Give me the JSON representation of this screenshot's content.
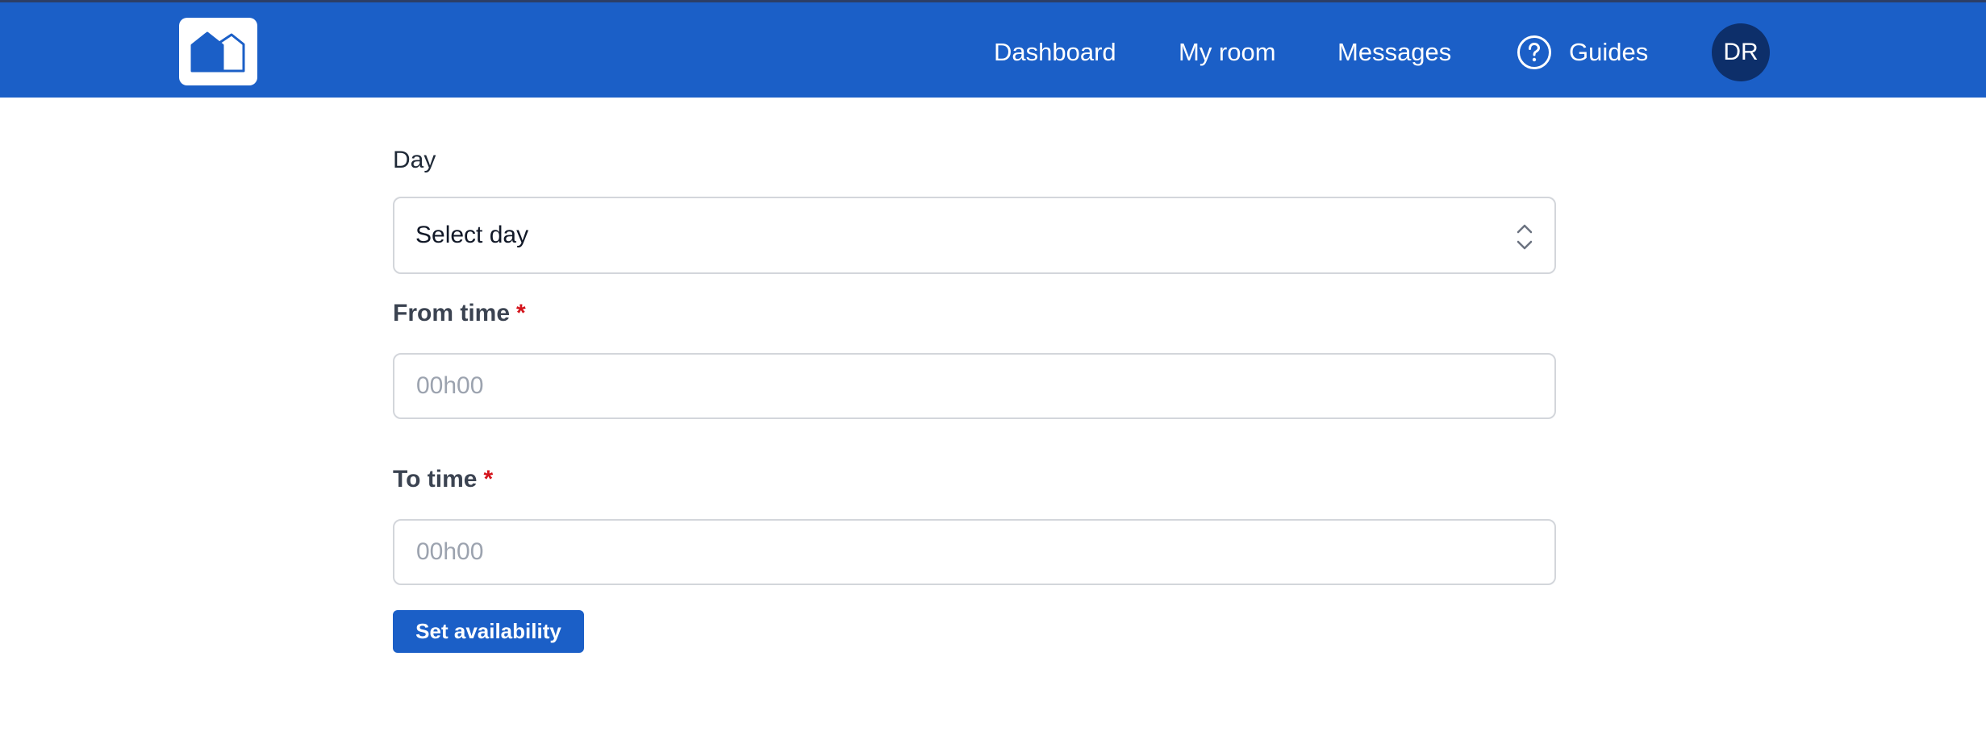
{
  "header": {
    "logo_icon": "house-logo-icon",
    "nav": {
      "dashboard": "Dashboard",
      "my_room": "My room",
      "messages": "Messages",
      "guides": "Guides",
      "guides_icon": "help-circle-icon"
    },
    "avatar_initials": "DR",
    "background_color": "#1b5fc7"
  },
  "form": {
    "day": {
      "label": "Day",
      "selected": "Select day"
    },
    "from_time": {
      "label": "From time",
      "required_mark": "*",
      "value": "",
      "placeholder": "00h00"
    },
    "to_time": {
      "label": "To time",
      "required_mark": "*",
      "value": "",
      "placeholder": "00h00"
    },
    "submit_label": "Set availability"
  },
  "colors": {
    "primary": "#1b5fc7",
    "avatar": "#0d2f6a",
    "required": "#d4141c"
  }
}
